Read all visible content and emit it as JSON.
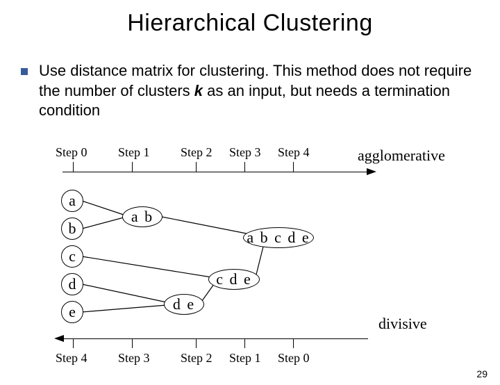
{
  "title": "Hierarchical Clustering",
  "bullet": {
    "pre": "Use distance matrix for clustering. This method does not require the number of clusters ",
    "k": "k",
    "post": " as an input, but needs a termination condition"
  },
  "top_steps": [
    "Step 0",
    "Step 1",
    "Step 2",
    "Step 3",
    "Step 4"
  ],
  "bot_steps": [
    "Step 4",
    "Step 3",
    "Step 2",
    "Step 1",
    "Step 0"
  ],
  "labels": {
    "agglomerative": "agglomerative",
    "divisive": "divisive"
  },
  "nodes": {
    "a": "a",
    "b": "b",
    "c": "c",
    "d": "d",
    "e": "e",
    "ab": "a b",
    "de": "d e",
    "cde": "c d e",
    "all": "a b c d e"
  },
  "page_number": "29"
}
